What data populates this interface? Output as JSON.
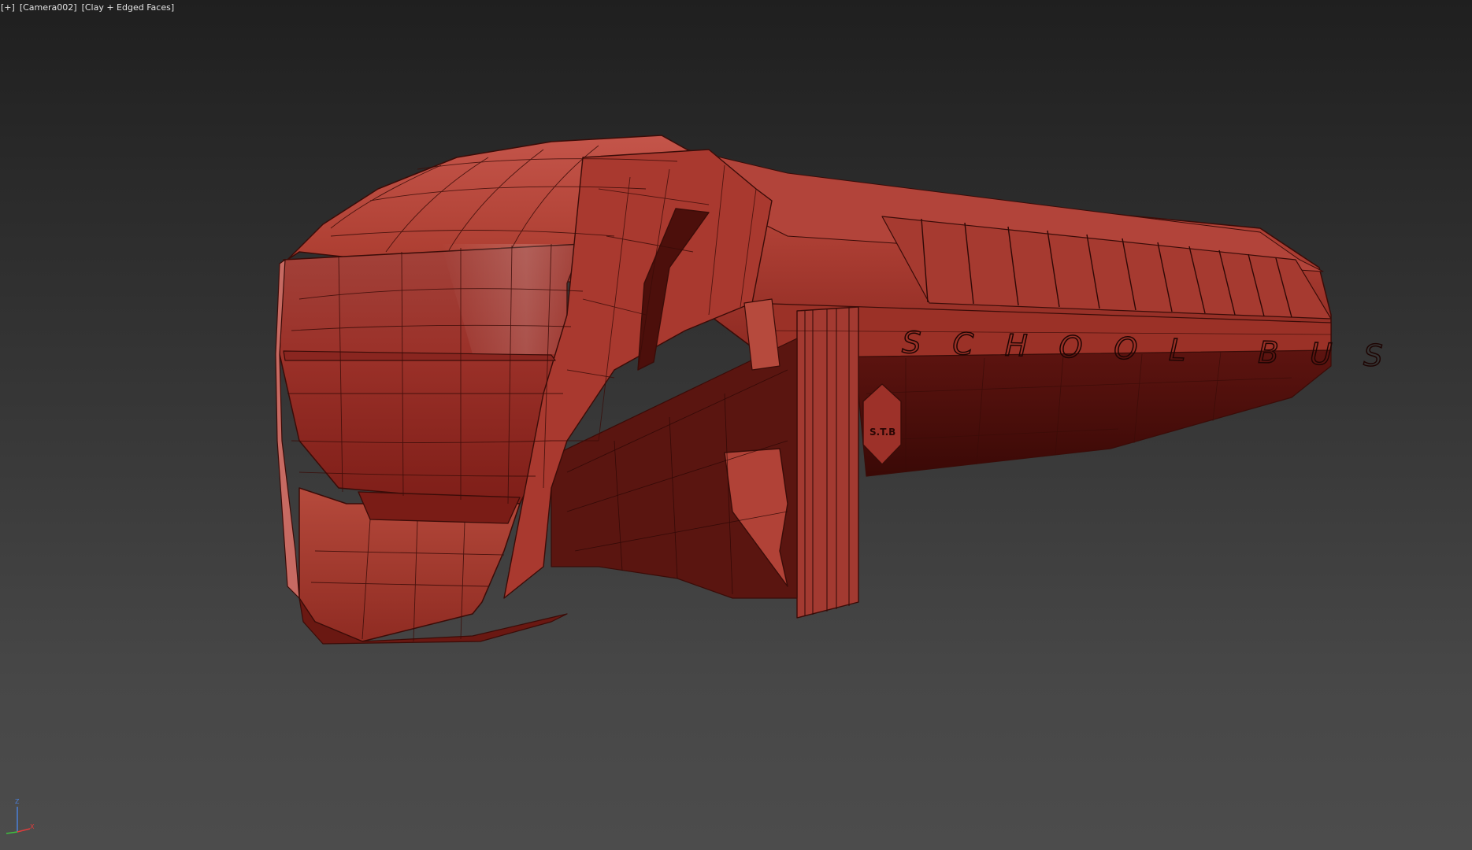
{
  "viewport": {
    "labels": [
      "[+]",
      "[Camera002]",
      "[Clay + Edged Faces]"
    ],
    "background_top": "#1f1f1f",
    "background_bottom": "#4c4c4c"
  },
  "model": {
    "text_on_side": "SCHOOL BUS",
    "plate_text": "S.T.B",
    "base_color": "#a8392c",
    "edge_color": "#3a0c08"
  },
  "axis_gizmo": {
    "z": "Z",
    "x": "X",
    "colors": {
      "x": "#e03c3c",
      "y": "#3ec23e",
      "z": "#4a7fd8"
    }
  }
}
